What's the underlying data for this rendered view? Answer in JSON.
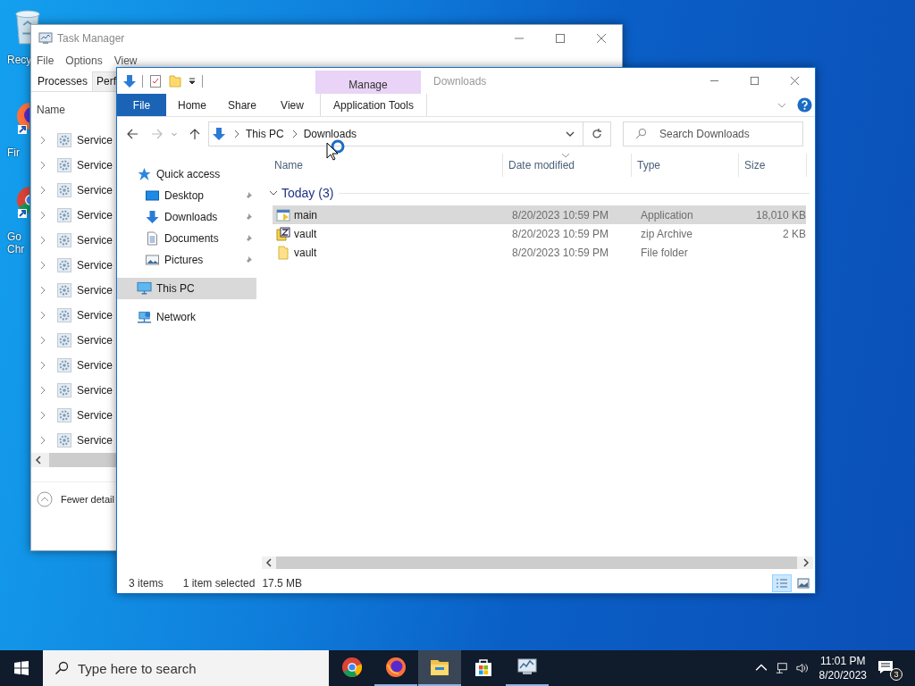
{
  "desktop": {
    "icons": [
      {
        "kind": "recycle_bin",
        "label_lines": [
          "Recy"
        ]
      },
      {
        "kind": "firefox",
        "label_lines": [
          "Fir"
        ]
      },
      {
        "kind": "chrome",
        "label_lines": [
          "Go",
          "Chr"
        ]
      }
    ]
  },
  "task_manager": {
    "title": "Task Manager",
    "menu": [
      "File",
      "Options",
      "View"
    ],
    "tabs": [
      {
        "label": "Processes",
        "selected": true
      },
      {
        "label": "Perf",
        "selected": false
      }
    ],
    "column": "Name",
    "rows": [
      {
        "name": "Service",
        "expanded": false
      },
      {
        "name": "Service",
        "expanded": false
      },
      {
        "name": "Service",
        "expanded": false
      },
      {
        "name": "Service",
        "expanded": false
      },
      {
        "name": "Service",
        "expanded": false
      },
      {
        "name": "Service",
        "expanded": false
      },
      {
        "name": "Service",
        "expanded": false
      },
      {
        "name": "Service",
        "expanded": false
      },
      {
        "name": "Service",
        "expanded": false
      },
      {
        "name": "Service",
        "expanded": false
      },
      {
        "name": "Service",
        "expanded": false
      },
      {
        "name": "Service",
        "expanded": false
      },
      {
        "name": "Service",
        "expanded": false
      }
    ],
    "footer": "Fewer detail"
  },
  "explorer": {
    "title": "Downloads",
    "context_tab": "Manage",
    "ribbon_tabs": [
      {
        "label": "File",
        "kind": "file"
      },
      {
        "label": "Home",
        "kind": "tab"
      },
      {
        "label": "Share",
        "kind": "tab"
      },
      {
        "label": "View",
        "kind": "tab"
      },
      {
        "label": "Application Tools",
        "kind": "context"
      }
    ],
    "address": [
      "This PC",
      "Downloads"
    ],
    "search": {
      "placeholder": "Search Downloads"
    },
    "nav": [
      {
        "label": "Quick access",
        "kind": "quick",
        "selected": false,
        "children": [
          {
            "label": "Desktop",
            "kind": "desktop",
            "pinned": true,
            "selected": false
          },
          {
            "label": "Downloads",
            "kind": "downloads",
            "pinned": true,
            "selected": false
          },
          {
            "label": "Documents",
            "kind": "documents",
            "pinned": true,
            "selected": false
          },
          {
            "label": "Pictures",
            "kind": "pictures",
            "pinned": true,
            "selected": false
          }
        ]
      },
      {
        "label": "This PC",
        "kind": "pc",
        "selected": true
      },
      {
        "label": "Network",
        "kind": "network",
        "selected": false
      }
    ],
    "columns": [
      "Name",
      "Date modified",
      "Type",
      "Size"
    ],
    "group": {
      "label": "Today (3)",
      "expanded": true
    },
    "files": [
      {
        "name": "main",
        "kind": "application",
        "date": "8/20/2023 10:59 PM",
        "type": "Application",
        "size": "18,010 KB",
        "selected": true
      },
      {
        "name": "vault",
        "kind": "zip",
        "date": "8/20/2023 10:59 PM",
        "type": "zip Archive",
        "size": "2 KB",
        "selected": false
      },
      {
        "name": "vault",
        "kind": "folder",
        "date": "8/20/2023 10:59 PM",
        "type": "File folder",
        "selected": false
      }
    ],
    "status": {
      "count": "3 items",
      "selection": "1 item selected",
      "selection_size": "17.5 MB"
    },
    "views": [
      {
        "kind": "details",
        "selected": true
      },
      {
        "kind": "tiles",
        "selected": false
      }
    ]
  },
  "taskbar": {
    "search": {
      "placeholder": "Type here to search"
    },
    "apps": [
      {
        "kind": "chrome",
        "running": false,
        "active": false
      },
      {
        "kind": "firefox",
        "running": true,
        "active": false
      },
      {
        "kind": "explorer",
        "running": true,
        "active": true
      },
      {
        "kind": "store",
        "running": false,
        "active": false
      },
      {
        "kind": "taskmgr",
        "running": true,
        "active": false
      }
    ],
    "time": "11:01 PM",
    "date": "8/20/2023",
    "notifications": "3"
  }
}
